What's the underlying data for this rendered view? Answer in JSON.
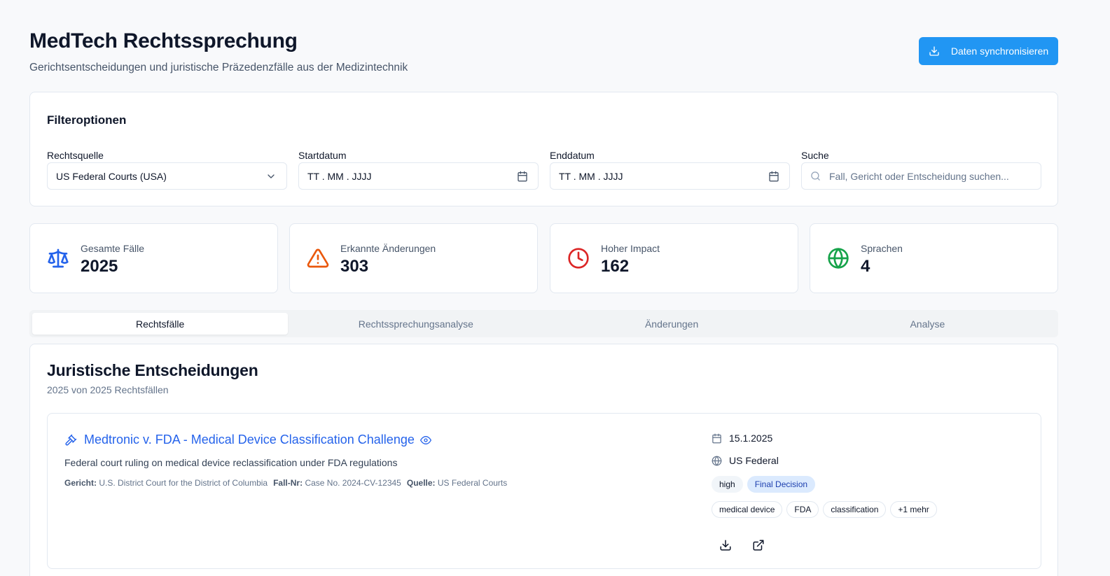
{
  "header": {
    "title": "MedTech Rechtssprechung",
    "subtitle": "Gerichtsentscheidungen und juristische Präzedenzfälle aus der Medizintechnik",
    "sync_label": "Daten synchronisieren"
  },
  "filters": {
    "title": "Filteroptionen",
    "source_label": "Rechtsquelle",
    "source_value": "US Federal Courts (USA)",
    "start_label": "Startdatum",
    "start_placeholder": "TT . MM . JJJJ",
    "end_label": "Enddatum",
    "end_placeholder": "TT . MM . JJJJ",
    "search_label": "Suche",
    "search_placeholder": "Fall, Gericht oder Entscheidung suchen..."
  },
  "stats": [
    {
      "label": "Gesamte Fälle",
      "value": "2025",
      "icon": "scale-icon",
      "color": "#2563eb"
    },
    {
      "label": "Erkannte Änderungen",
      "value": "303",
      "icon": "alert-triangle-icon",
      "color": "#ea580c"
    },
    {
      "label": "Hoher Impact",
      "value": "162",
      "icon": "clock-icon",
      "color": "#dc2626"
    },
    {
      "label": "Sprachen",
      "value": "4",
      "icon": "globe-icon",
      "color": "#16a34a"
    }
  ],
  "tabs": [
    "Rechtsfälle",
    "Rechtssprechungsanalyse",
    "Änderungen",
    "Analyse"
  ],
  "active_tab": "Rechtsfälle",
  "decisions": {
    "title": "Juristische Entscheidungen",
    "subtitle": "2025 von 2025 Rechtsfällen",
    "cases": [
      {
        "title": "Medtronic v. FDA - Medical Device Classification Challenge",
        "description": "Federal court ruling on medical device reclassification under FDA regulations",
        "court_label": "Gericht:",
        "court": "U.S. District Court for the District of Columbia",
        "case_no_label": "Fall-Nr:",
        "case_no": "Case No. 2024-CV-12345",
        "source_label": "Quelle:",
        "source": "US Federal Courts",
        "date": "15.1.2025",
        "jurisdiction": "US Federal",
        "impact": "high",
        "status": "Final Decision",
        "tags": [
          "medical device",
          "FDA",
          "classification",
          "+1 mehr"
        ]
      }
    ]
  }
}
